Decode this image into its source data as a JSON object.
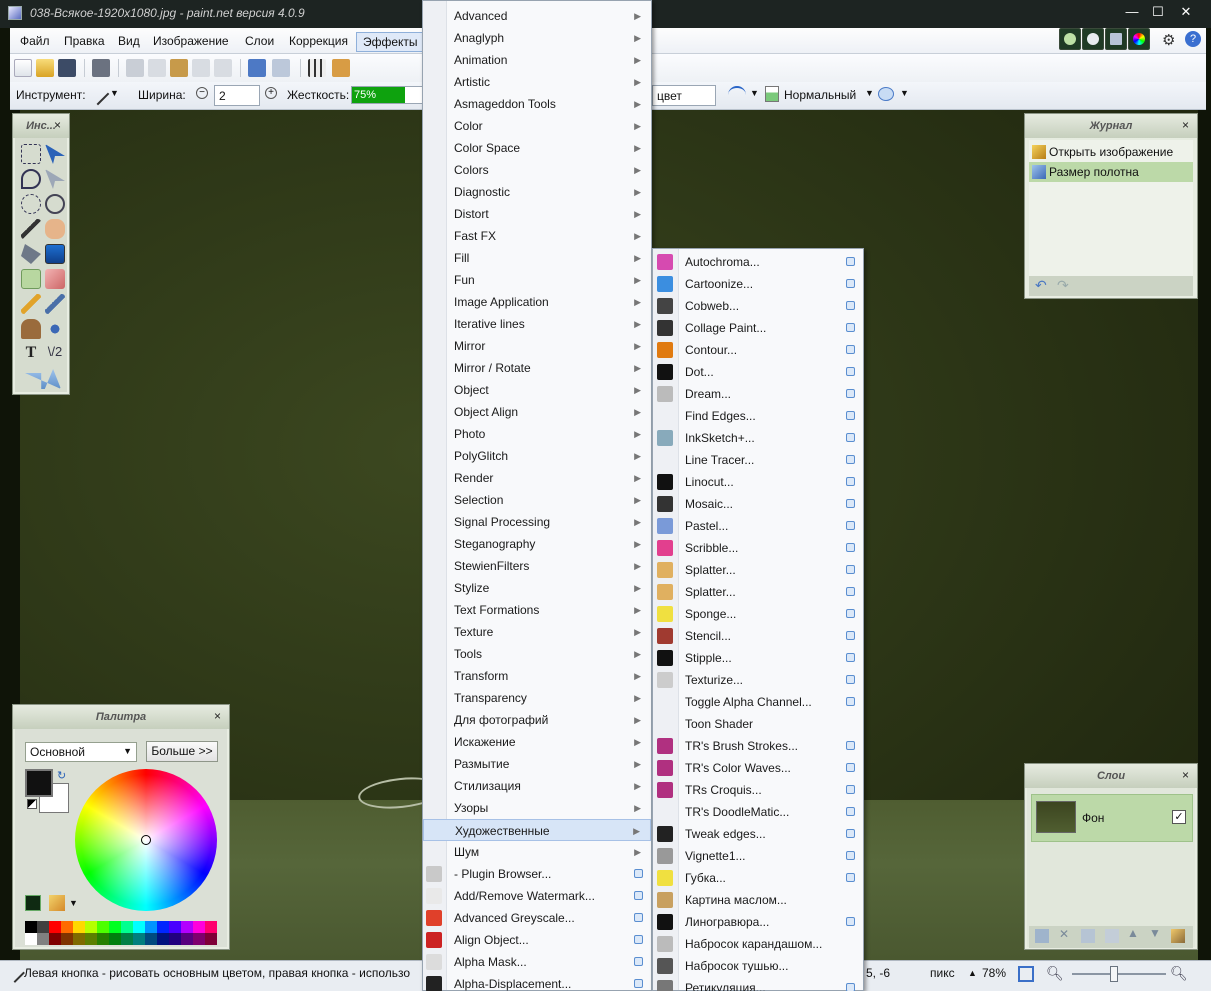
{
  "window": {
    "title": "038-Всякое-1920x1080.jpg - paint.net версия 4.0.9",
    "controls": [
      "—",
      "☐",
      "✕"
    ]
  },
  "menubar": {
    "items": [
      "Файл",
      "Правка",
      "Вид",
      "Изображение",
      "Слои",
      "Коррекция",
      "Эффекты"
    ],
    "active": "Эффекты"
  },
  "toolbar2": {
    "tool_label": "Инструмент:",
    "width_label": "Ширина:",
    "width_value": "2",
    "hardness_label": "Жесткость:",
    "hardness_value": "75%",
    "hardness_fraction": 0.75,
    "color_mode": "цвет",
    "blend_mode": "Нормальный"
  },
  "effects_menu": {
    "items": [
      "Advanced",
      "Anaglyph",
      "Animation",
      "Artistic",
      "Asmageddon Tools",
      "Color",
      "Color Space",
      "Colors",
      "Diagnostic",
      "Distort",
      "Fast FX",
      "Fill",
      "Fun",
      "Image Application",
      "Iterative lines",
      "Mirror",
      "Mirror / Rotate",
      "Object",
      "Object Align",
      "Photo",
      "PolyGlitch",
      "Render",
      "Selection",
      "Signal Processing",
      "Steganography",
      "StewienFilters",
      "Stylize",
      "Text Formations",
      "Texture",
      "Tools",
      "Transform",
      "Transparency",
      "Для фотографий",
      "Искажение",
      "Размытие",
      "Стилизация",
      "Узоры",
      "Художественные",
      "Шум"
    ],
    "highlighted": "Художественные",
    "plugin_items": [
      "- Plugin Browser...",
      "Add/Remove Watermark...",
      "Advanced Greyscale...",
      "Align Object...",
      "Alpha Mask...",
      "Alpha-Displacement..."
    ]
  },
  "artistic_menu": {
    "items": [
      "Autochroma...",
      "Cartoonize...",
      "Cobweb...",
      "Collage Paint...",
      "Contour...",
      "Dot...",
      "Dream...",
      "Find Edges...",
      "InkSketch+...",
      "Line Tracer...",
      "Linocut...",
      "Mosaic...",
      "Pastel...",
      "Scribble...",
      "Splatter...",
      "Splatter...",
      "Sponge...",
      "Stencil...",
      "Stipple...",
      "Texturize...",
      "Toggle Alpha Channel...",
      "Toon Shader",
      "TR's Brush Strokes...",
      "TR's Color Waves...",
      "TRs Croquis...",
      "TR's DoodleMatic...",
      "Tweak edges...",
      "Vignette1...",
      "Губка...",
      "Картина маслом...",
      "Линогравюра...",
      "Набросок карандашом...",
      "Набросок тушью...",
      "Ретикуляция..."
    ]
  },
  "tools_panel": {
    "title": "Инс..."
  },
  "history_panel": {
    "title": "Журнал",
    "items": [
      "Открыть изображение",
      "Размер полотна"
    ],
    "selected": "Размер полотна"
  },
  "palette_panel": {
    "title": "Палитра",
    "mode": "Основной",
    "more_button": "Больше >>",
    "primary_color": "#111111",
    "secondary_color": "#ffffff"
  },
  "layers_panel": {
    "title": "Слои",
    "layer_name": "Фон"
  },
  "statusbar": {
    "hint": "Левая кнопка - рисовать основным цветом, правая кнопка - использо",
    "coords": "5, -6",
    "units": "пикс",
    "zoom": "78%"
  },
  "colors": {
    "accent": "#dfe9f8",
    "hardness_fill": "#0ea20e",
    "selection": "#bcd9a8"
  }
}
